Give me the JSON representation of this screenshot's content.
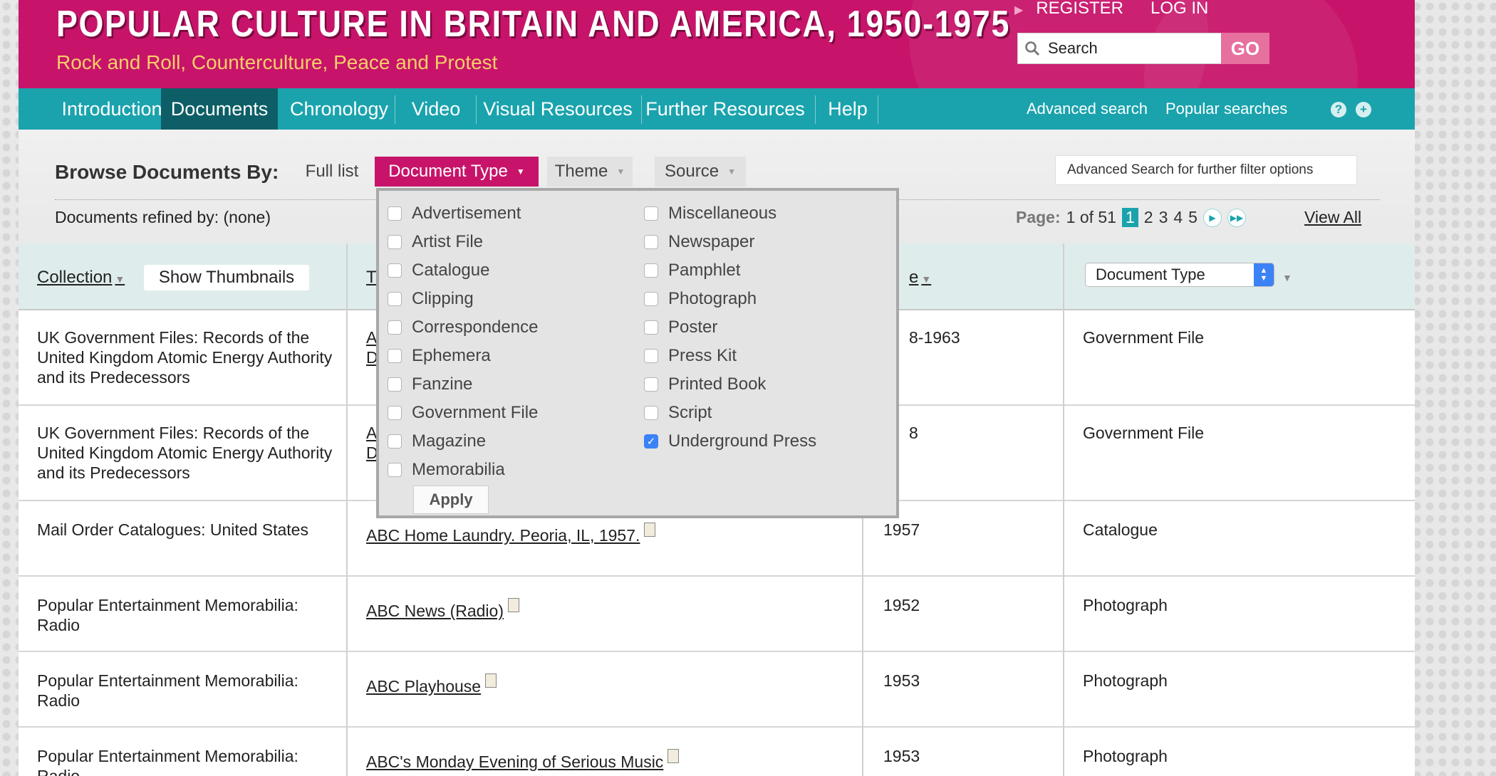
{
  "header": {
    "title": "POPULAR CULTURE IN BRITAIN AND AMERICA, 1950-1975",
    "subtitle": "Rock and Roll, Counterculture, Peace and Protest",
    "register": "REGISTER",
    "login": "LOG IN",
    "search_placeholder": "Search",
    "go": "GO"
  },
  "nav": {
    "items": [
      "Introduction",
      "Documents",
      "Chronology",
      "Video",
      "Visual Resources",
      "Further Resources",
      "Help"
    ],
    "active": "Documents",
    "advanced_search": "Advanced search",
    "popular_searches": "Popular searches",
    "help_icon": "?",
    "plus_icon": "+"
  },
  "browse": {
    "label": "Browse Documents By:",
    "tabs": [
      "Full list",
      "Document Type",
      "Theme",
      "Source"
    ],
    "active_tab": "Document Type",
    "advanced_filter": "Advanced Search for further filter options",
    "refined": "Documents refined by: (none)",
    "pager": {
      "label": "Page:",
      "position": "1 of 51",
      "pages": [
        "1",
        "2",
        "3",
        "4",
        "5"
      ],
      "current": "1",
      "view_all": "View All"
    }
  },
  "table": {
    "headers": {
      "collection": "Collection",
      "show_thumbnails": "Show Thumbnails",
      "title_partial": "T",
      "date_partial": "e",
      "document_type_select": "Document Type"
    },
    "rows": [
      {
        "collection": "UK Government Files: Records of the United Kingdom Atomic Energy Authority and its Predecessors",
        "title_partial": "A D",
        "date_partial": "8-1963",
        "type": "Government File"
      },
      {
        "collection": "UK Government Files: Records of the United Kingdom Atomic Energy Authority and its Predecessors",
        "title_partial": "A D",
        "date_partial": "8",
        "type": "Government File"
      },
      {
        "collection": "Mail Order Catalogues: United States",
        "title": "ABC Home Laundry. Peoria, IL, 1957.",
        "date_partial": "1957",
        "type": "Catalogue"
      },
      {
        "collection": "Popular Entertainment Memorabilia: Radio",
        "title": "ABC News (Radio)",
        "date": "1952",
        "type": "Photograph"
      },
      {
        "collection": "Popular Entertainment Memorabilia: Radio",
        "title": "ABC Playhouse",
        "date": "1953",
        "type": "Photograph"
      },
      {
        "collection": "Popular Entertainment Memorabilia: Radio",
        "title": "ABC's Monday Evening of Serious Music",
        "date": "1953",
        "type": "Photograph"
      }
    ]
  },
  "dropdown": {
    "left": [
      "Advertisement",
      "Artist File",
      "Catalogue",
      "Clipping",
      "Correspondence",
      "Ephemera",
      "Fanzine",
      "Government File",
      "Magazine",
      "Memorabilia"
    ],
    "right": [
      "Miscellaneous",
      "Newspaper",
      "Pamphlet",
      "Photograph",
      "Poster",
      "Press Kit",
      "Printed Book",
      "Script",
      "Underground Press"
    ],
    "checked": [
      "Underground Press"
    ],
    "apply": "Apply"
  },
  "colors": {
    "brand_magenta": "#c7146a",
    "nav_teal": "#1aa3ad",
    "nav_active": "#0d5e66",
    "subtitle_gold": "#f6cf67",
    "checkbox_blue": "#3b82f6"
  }
}
